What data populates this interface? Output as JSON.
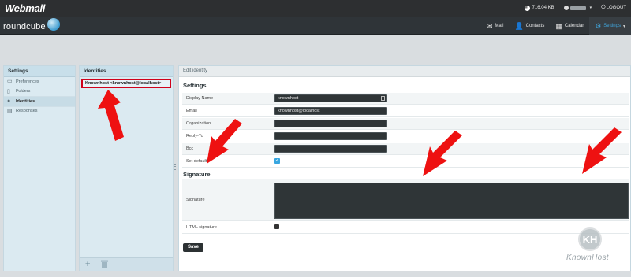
{
  "topbar": {
    "logo": "Webmail",
    "quota": "716.04 KB",
    "user": "username",
    "logout": "LOGOUT"
  },
  "navbar": {
    "logo": "roundcube",
    "items": [
      {
        "label": "Mail",
        "icon": "envelope-icon"
      },
      {
        "label": "Contacts",
        "icon": "person-icon"
      },
      {
        "label": "Calendar",
        "icon": "calendar-icon"
      },
      {
        "label": "Settings",
        "icon": "gear-icon",
        "active": true
      }
    ]
  },
  "settings_panel": {
    "title": "Settings",
    "items": [
      {
        "label": "Preferences",
        "icon": "laptop-icon"
      },
      {
        "label": "Folders",
        "icon": "folder-icon"
      },
      {
        "label": "Identities",
        "icon": "person-icon",
        "selected": true
      },
      {
        "label": "Responses",
        "icon": "document-icon"
      }
    ]
  },
  "identities_panel": {
    "title": "Identities",
    "selected_identity": "Knownhost <knownhost@localhost>",
    "add_label": "+",
    "delete_label": "🗑"
  },
  "edit_panel": {
    "title": "Edit identity",
    "settings_section": "Settings",
    "fields": {
      "display_name": {
        "label": "Display Name",
        "value": "knownhost"
      },
      "email": {
        "label": "Email",
        "value": "knownhost@localhost"
      },
      "organization": {
        "label": "Organization",
        "value": ""
      },
      "reply_to": {
        "label": "Reply-To",
        "value": ""
      },
      "bcc": {
        "label": "Bcc",
        "value": ""
      },
      "set_default": {
        "label": "Set default",
        "checked": true
      }
    },
    "signature_section": "Signature",
    "signature_label": "Signature",
    "html_signature_label": "HTML signature",
    "save_label": "Save"
  },
  "watermark": {
    "logo_letters": "KH",
    "text": "KnownHost"
  },
  "colors": {
    "accent": "#40a7de",
    "highlight_border": "#d0021b",
    "arrow": "#ee1111"
  }
}
